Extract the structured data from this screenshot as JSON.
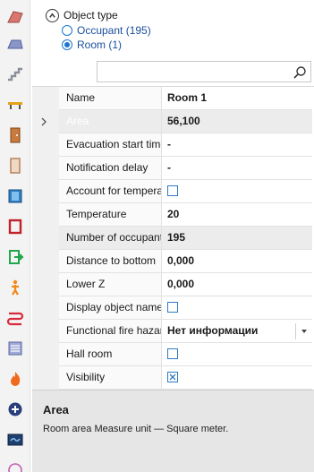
{
  "object_type": {
    "label": "Object type",
    "options": [
      {
        "label": "Occupant (195)",
        "selected": false
      },
      {
        "label": "Room (1)",
        "selected": true
      }
    ]
  },
  "search": {
    "value": "",
    "placeholder": ""
  },
  "properties": {
    "name": {
      "label": "Name",
      "value": "Room 1"
    },
    "area": {
      "label": "Area",
      "value": "56,100"
    },
    "evacuation_start_time": {
      "label": "Evacuation start time",
      "value": "-"
    },
    "notification_delay": {
      "label": "Notification delay",
      "value": "-"
    },
    "account_for_temperature": {
      "label": "Account for temperature",
      "checked": false
    },
    "temperature": {
      "label": "Temperature",
      "value": "20"
    },
    "number_of_occupants": {
      "label": "Number of occupants",
      "value": "195"
    },
    "distance_to_bottom": {
      "label": "Distance to bottom",
      "value": "0,000"
    },
    "lower_z": {
      "label": "Lower Z",
      "value": "0,000"
    },
    "display_object_name": {
      "label": "Display object name",
      "checked": false
    },
    "functional_fire_hazard": {
      "label": "Functional fire hazard",
      "value": "Нет информации"
    },
    "hall_room": {
      "label": "Hall room",
      "checked": false
    },
    "visibility": {
      "label": "Visibility",
      "checked": true
    }
  },
  "description": {
    "title": "Area",
    "text": "Room area Measure unit — Square meter."
  },
  "toolbar_icons": [
    "roof-icon",
    "slab-icon",
    "stairs-icon",
    "beam-icon",
    "door-icon",
    "door-frame-icon",
    "window-icon",
    "opening-icon",
    "exit-icon",
    "occupant-icon",
    "route-icon",
    "room-icon",
    "fire-icon",
    "add-circle-icon",
    "monitor-icon"
  ],
  "colors": {
    "selection": "#2e8fd8",
    "accent_blue": "#1976d2",
    "toolbar_bg": "#f3f3f3"
  }
}
